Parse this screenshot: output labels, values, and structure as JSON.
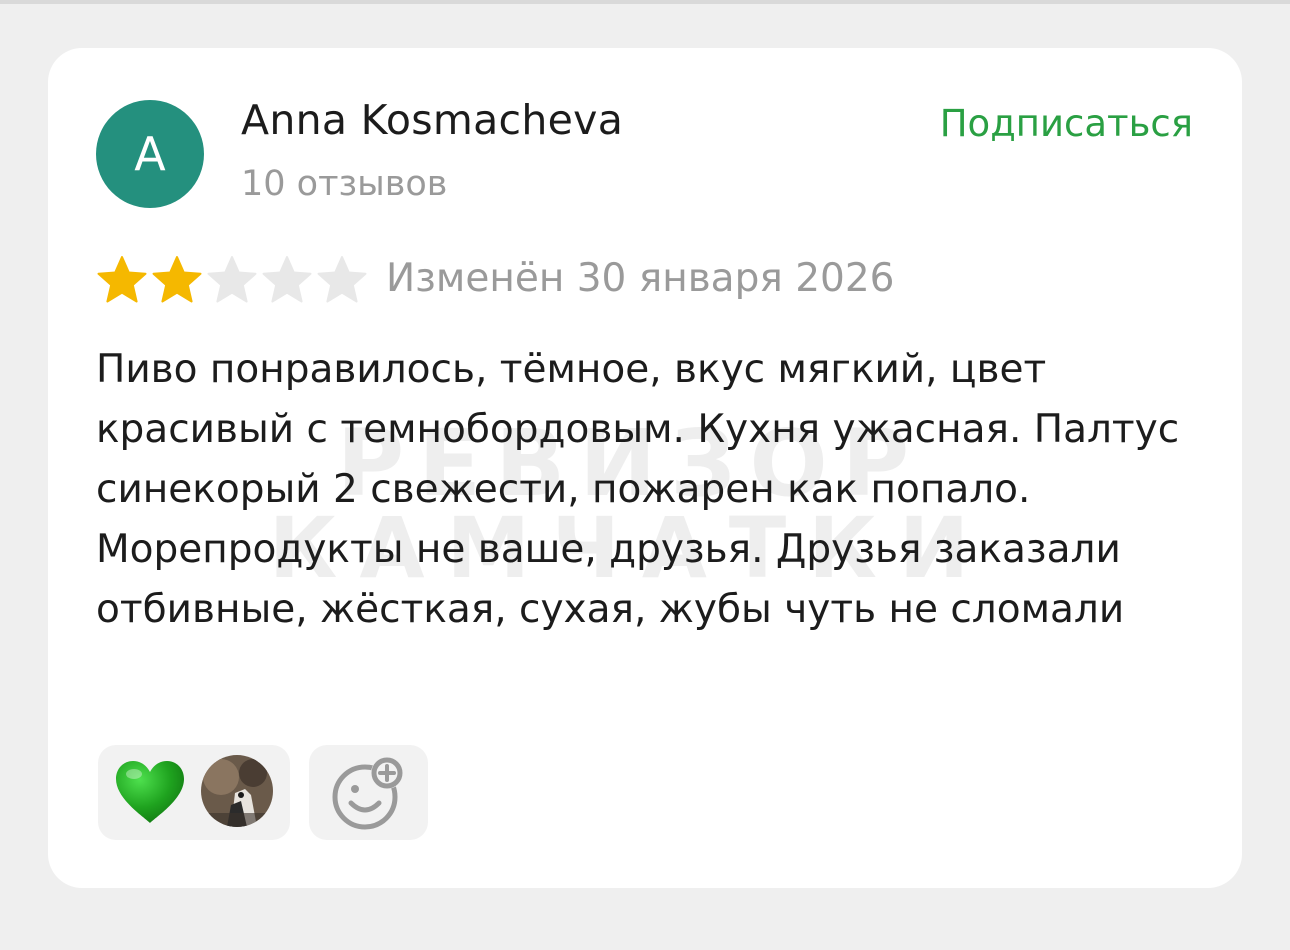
{
  "author": {
    "initial": "A",
    "name": "Anna Kosmacheva",
    "review_count": "10 отзывов",
    "avatar_color": "#24907e"
  },
  "subscribe_label": "Подписаться",
  "rating": {
    "value": 2,
    "max": 5,
    "filled_color": "#f5b800",
    "empty_color": "#e8e8e8"
  },
  "date": "Изменён 30 января 2026",
  "review_text": "Пиво понравилось, тёмное, вкус мягкий, цвет красивый с темнобордовым. Кухня ужасная. Палтус синекорый 2 свежести, пожарен как попало. Морепродукты не ваше, друзья. Друзья заказали отбивные, жёсткая, сухая, жубы чуть не сломали",
  "watermark": {
    "line1": "РЕВИЗОР",
    "line2": "КАМЧАТКИ"
  },
  "reactions": {
    "items": [
      "green-heart-icon",
      "user-avatar"
    ],
    "add_icon": "add-reaction-icon",
    "heart_color": "#1fa31f"
  }
}
